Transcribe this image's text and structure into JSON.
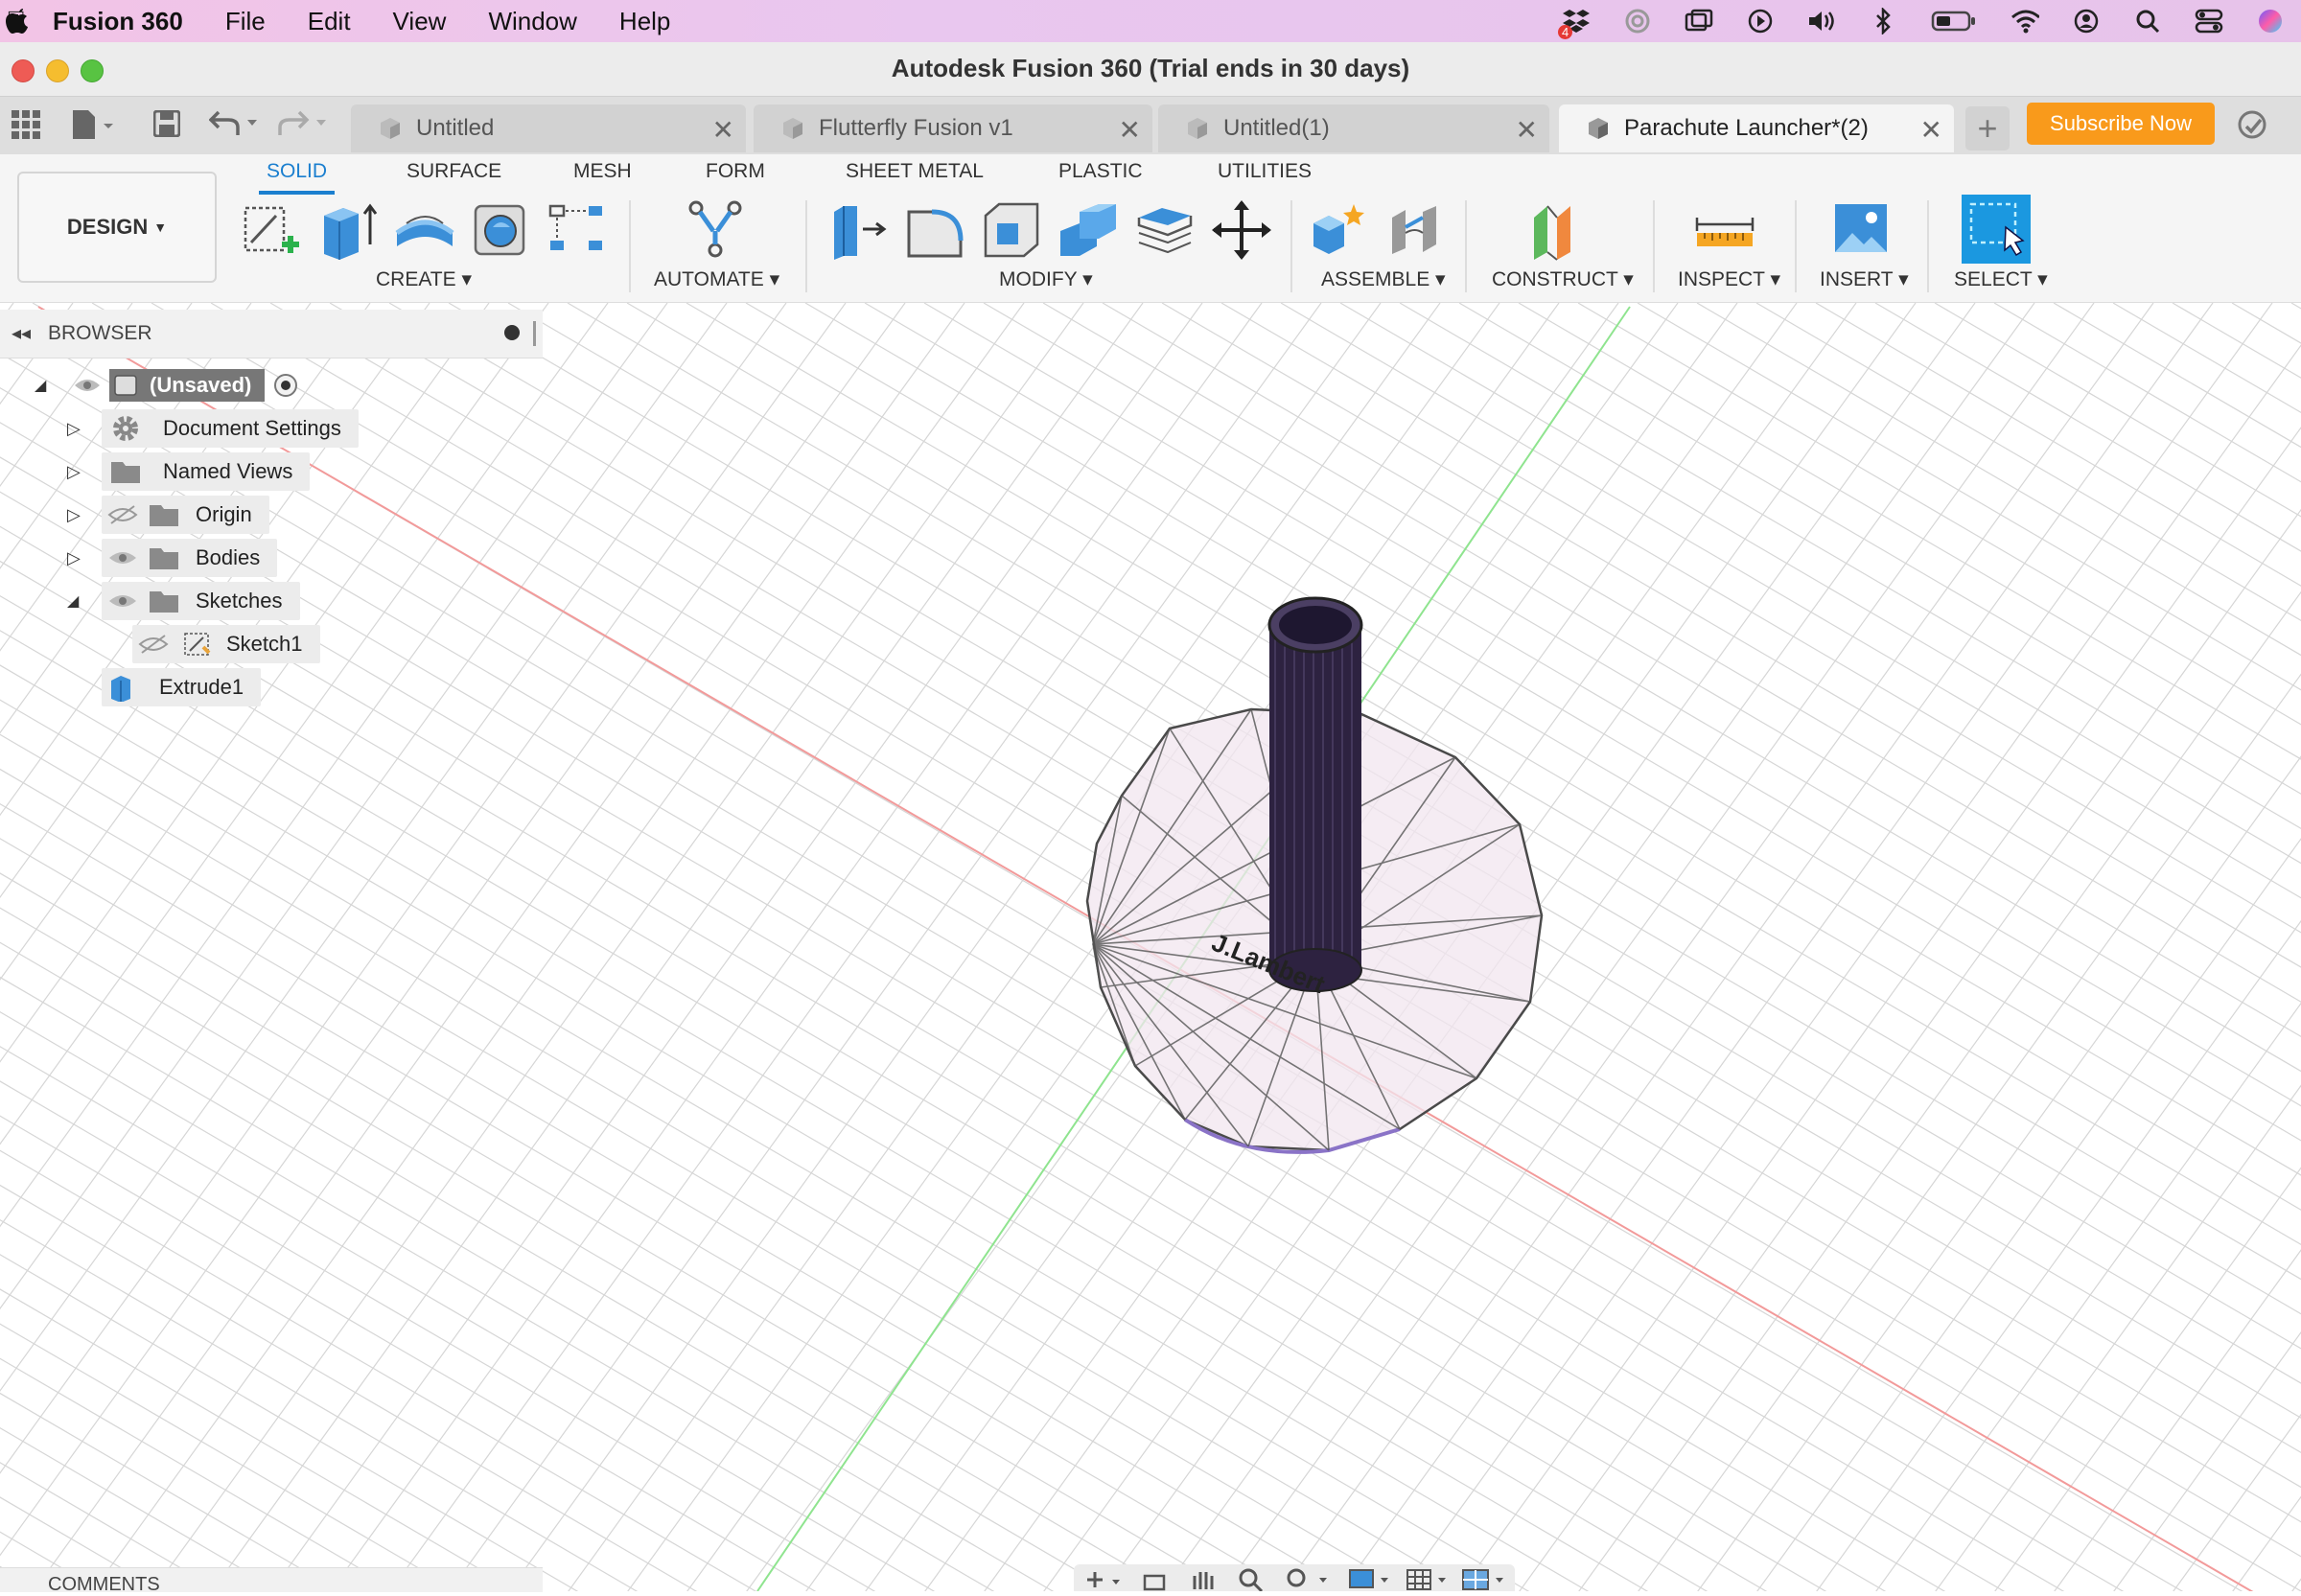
{
  "menubar": {
    "app_name": "Fusion 360",
    "items": [
      "File",
      "Edit",
      "View",
      "Window",
      "Help"
    ],
    "status_icons": [
      "dropbox-icon",
      "spiral-icon",
      "screen-mirror-icon",
      "play-icon",
      "volume-icon",
      "bluetooth-icon",
      "battery-icon",
      "wifi-icon",
      "user-icon",
      "search-icon",
      "control-center-icon",
      "siri-icon"
    ],
    "dropbox_badge": "4"
  },
  "window": {
    "title": "Autodesk Fusion 360 (Trial ends in 30 days)"
  },
  "tabs": [
    {
      "label": "Untitled",
      "active": false
    },
    {
      "label": "Flutterfly Fusion v1",
      "active": false
    },
    {
      "label": "Untitled(1)",
      "active": false
    },
    {
      "label": "Parachute Launcher*(2)",
      "active": true
    }
  ],
  "subscribe_label": "Subscribe Now",
  "toolbar": {
    "workspace": "DESIGN",
    "tabs": [
      "SOLID",
      "SURFACE",
      "MESH",
      "FORM",
      "SHEET METAL",
      "PLASTIC",
      "UTILITIES"
    ],
    "groups": {
      "create": "CREATE",
      "automate": "AUTOMATE",
      "modify": "MODIFY",
      "assemble": "ASSEMBLE",
      "construct": "CONSTRUCT",
      "inspect": "INSPECT",
      "insert": "INSERT",
      "select": "SELECT"
    },
    "accent_color": "#1b7fcf"
  },
  "browser": {
    "title": "BROWSER",
    "root": "(Unsaved)",
    "items": {
      "document_settings": "Document Settings",
      "named_views": "Named Views",
      "origin": "Origin",
      "bodies": "Bodies",
      "sketches": "Sketches",
      "sketch1": "Sketch1",
      "extrude1": "Extrude1"
    }
  },
  "comments_label": "COMMENTS",
  "viewport": {
    "axis_colors": {
      "x": "#f07c7c",
      "y": "#7fe07f"
    },
    "model_text": "J.Lambert"
  }
}
